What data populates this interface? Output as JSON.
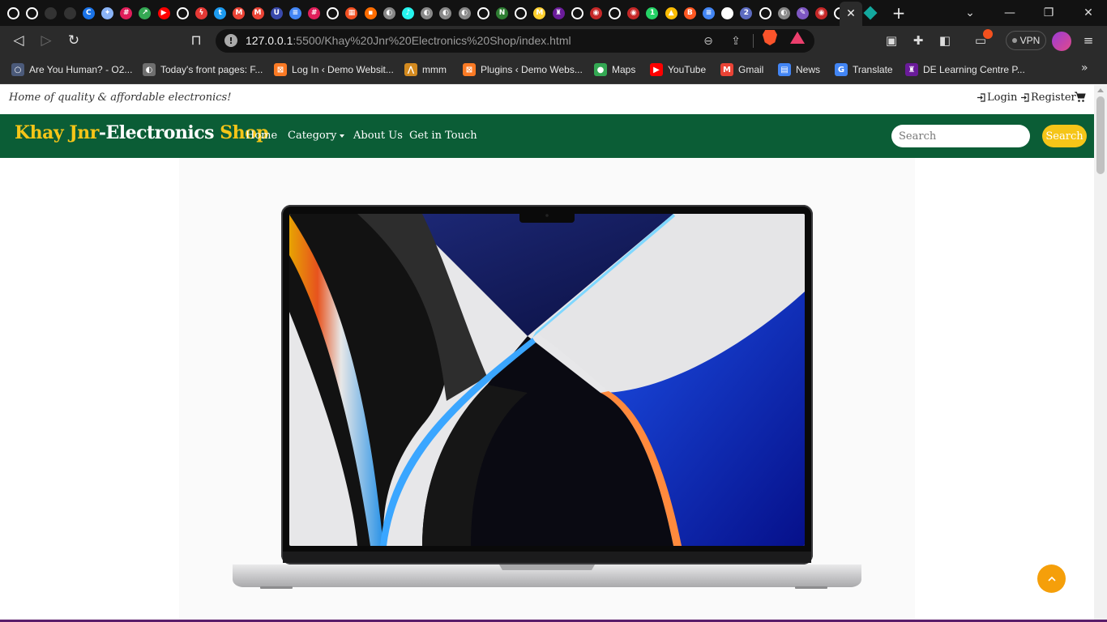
{
  "browser": {
    "tab_favicons": [
      {
        "icon": "github-icon",
        "color": "#ffffff",
        "glyph": ""
      },
      {
        "icon": "github-icon",
        "color": "#ffffff",
        "glyph": ""
      },
      {
        "icon": "dim-tab-icon",
        "color": "#333333",
        "glyph": ""
      },
      {
        "icon": "dim-tab-icon",
        "color": "#333333",
        "glyph": ""
      },
      {
        "icon": "chrome-c-icon",
        "color": "#1a73e8",
        "glyph": "C"
      },
      {
        "icon": "sparkle-icon",
        "color": "#8ab4f8",
        "glyph": "✦"
      },
      {
        "icon": "slack-icon",
        "color": "#e01e5a",
        "glyph": "#"
      },
      {
        "icon": "expand-icon",
        "color": "#34a853",
        "glyph": "↗"
      },
      {
        "icon": "youtube-icon",
        "color": "#ff0000",
        "glyph": "▶"
      },
      {
        "icon": "github-icon",
        "color": "#ffffff",
        "glyph": ""
      },
      {
        "icon": "bolt-icon",
        "color": "#e53935",
        "glyph": "ϟ"
      },
      {
        "icon": "twitter-icon",
        "color": "#1d9bf0",
        "glyph": "t"
      },
      {
        "icon": "gmail-icon",
        "color": "#ea4335",
        "glyph": "M"
      },
      {
        "icon": "gmail-icon",
        "color": "#ea4335",
        "glyph": "M"
      },
      {
        "icon": "u-icon",
        "color": "#3949ab",
        "glyph": "U"
      },
      {
        "icon": "docs-icon",
        "color": "#4285f4",
        "glyph": "≡"
      },
      {
        "icon": "slack-icon",
        "color": "#e01e5a",
        "glyph": "#"
      },
      {
        "icon": "github-icon",
        "color": "#ffffff",
        "glyph": ""
      },
      {
        "icon": "microsoft-icon",
        "color": "#f25022",
        "glyph": "▦"
      },
      {
        "icon": "squares-icon",
        "color": "#ff6d00",
        "glyph": "▪"
      },
      {
        "icon": "globe-icon",
        "color": "#888888",
        "glyph": "◐"
      },
      {
        "icon": "tiktok-icon",
        "color": "#25f4ee",
        "glyph": "♪"
      },
      {
        "icon": "globe-icon",
        "color": "#888888",
        "glyph": "◐"
      },
      {
        "icon": "globe-icon",
        "color": "#888888",
        "glyph": "◐"
      },
      {
        "icon": "globe-icon",
        "color": "#888888",
        "glyph": "◐"
      },
      {
        "icon": "github-icon",
        "color": "#ffffff",
        "glyph": ""
      },
      {
        "icon": "n-icon",
        "color": "#2e7d32",
        "glyph": "N"
      },
      {
        "icon": "github-icon",
        "color": "#ffffff",
        "glyph": ""
      },
      {
        "icon": "miro-icon",
        "color": "#ffd02f",
        "glyph": "M"
      },
      {
        "icon": "castle-icon",
        "color": "#6a1b9a",
        "glyph": "♜"
      },
      {
        "icon": "github-icon",
        "color": "#ffffff",
        "glyph": ""
      },
      {
        "icon": "brave-icon",
        "color": "#c62828",
        "glyph": "◉"
      },
      {
        "icon": "github-icon",
        "color": "#ffffff",
        "glyph": ""
      },
      {
        "icon": "brave-icon",
        "color": "#c62828",
        "glyph": "◉"
      },
      {
        "icon": "whatsapp-icon",
        "color": "#25d366",
        "glyph": "1"
      },
      {
        "icon": "drive-icon",
        "color": "#fbbc04",
        "glyph": "▲"
      },
      {
        "icon": "blogger-icon",
        "color": "#ff5722",
        "glyph": "B"
      },
      {
        "icon": "docs-icon",
        "color": "#4285f4",
        "glyph": "≡"
      },
      {
        "icon": "circle-icon",
        "color": "#ffffff",
        "glyph": "○"
      },
      {
        "icon": "notification-icon",
        "color": "#5c6bc0",
        "glyph": "2"
      },
      {
        "icon": "github-icon",
        "color": "#ffffff",
        "glyph": ""
      },
      {
        "icon": "globe-icon",
        "color": "#888888",
        "glyph": "◐"
      },
      {
        "icon": "pen-icon",
        "color": "#7e57c2",
        "glyph": "✎"
      },
      {
        "icon": "brave-icon",
        "color": "#c62828",
        "glyph": "◉"
      },
      {
        "icon": "github-icon",
        "color": "#ffffff",
        "glyph": ""
      }
    ],
    "active_tab_favicon": {
      "icon": "diamond-icon",
      "color": "#13a89e"
    },
    "close_tab_glyph": "✕",
    "new_tab_glyph": "+",
    "tab_search_glyph": "⌄",
    "minimize_glyph": "—",
    "restore_glyph": "❐",
    "close_window_glyph": "✕",
    "back_glyph": "◁",
    "forward_glyph": "▷",
    "reload_glyph": "↻",
    "bookmark_glyph": "⊓",
    "url_host": "127.0.0.1",
    "url_path": ":5500/Khay%20Jnr%20Electronics%20Shop/index.html",
    "info_glyph": "!",
    "zoom_glyph": "⊖",
    "share_glyph": "⇪",
    "vpn_label": "VPN",
    "menu_glyph": "≡",
    "more_bookmarks_glyph": "»",
    "bookmarks": [
      {
        "label": "Are You Human? - O2...",
        "icon": "o2-icon",
        "color": "#4b5a7a",
        "glyph": "○"
      },
      {
        "label": "Today's front pages: F...",
        "icon": "globe-icon",
        "color": "#6f6f6f",
        "glyph": "◐"
      },
      {
        "label": "Log In ‹ Demo Websit...",
        "icon": "xampp-icon",
        "color": "#fb7a24",
        "glyph": "⊠"
      },
      {
        "label": "mmm",
        "icon": "mountain-icon",
        "color": "#d38a1f",
        "glyph": "⋀"
      },
      {
        "label": "Plugins ‹ Demo Webs...",
        "icon": "xampp-icon",
        "color": "#fb7a24",
        "glyph": "⊠"
      },
      {
        "label": "Maps",
        "icon": "maps-pin-icon",
        "color": "#34a853",
        "glyph": "●"
      },
      {
        "label": "YouTube",
        "icon": "youtube-icon",
        "color": "#ff0000",
        "glyph": "▶"
      },
      {
        "label": "Gmail",
        "icon": "gmail-icon",
        "color": "#ea4335",
        "glyph": "M"
      },
      {
        "label": "News",
        "icon": "news-icon",
        "color": "#4285f4",
        "glyph": "▤"
      },
      {
        "label": "Translate",
        "icon": "translate-icon",
        "color": "#4285f4",
        "glyph": "G"
      },
      {
        "label": "DE Learning Centre P...",
        "icon": "castle-icon",
        "color": "#6a1b9a",
        "glyph": "♜"
      }
    ]
  },
  "site": {
    "tagline": "Home of quality & affordable electronics!",
    "login_label": "Login",
    "register_label": "Register",
    "brand_part1": "Khay Jnr",
    "brand_part2": "-Electronics ",
    "brand_part3": "Shop",
    "nav": {
      "home": "Home",
      "category": "Category",
      "about": "About Us",
      "contact": "Get in Touch"
    },
    "search_placeholder": "Search",
    "search_button": "Search",
    "colors": {
      "navbar_green": "#0b5d36",
      "brand_yellow": "#f5c518",
      "scroll_top_orange": "#f59f0a"
    }
  }
}
